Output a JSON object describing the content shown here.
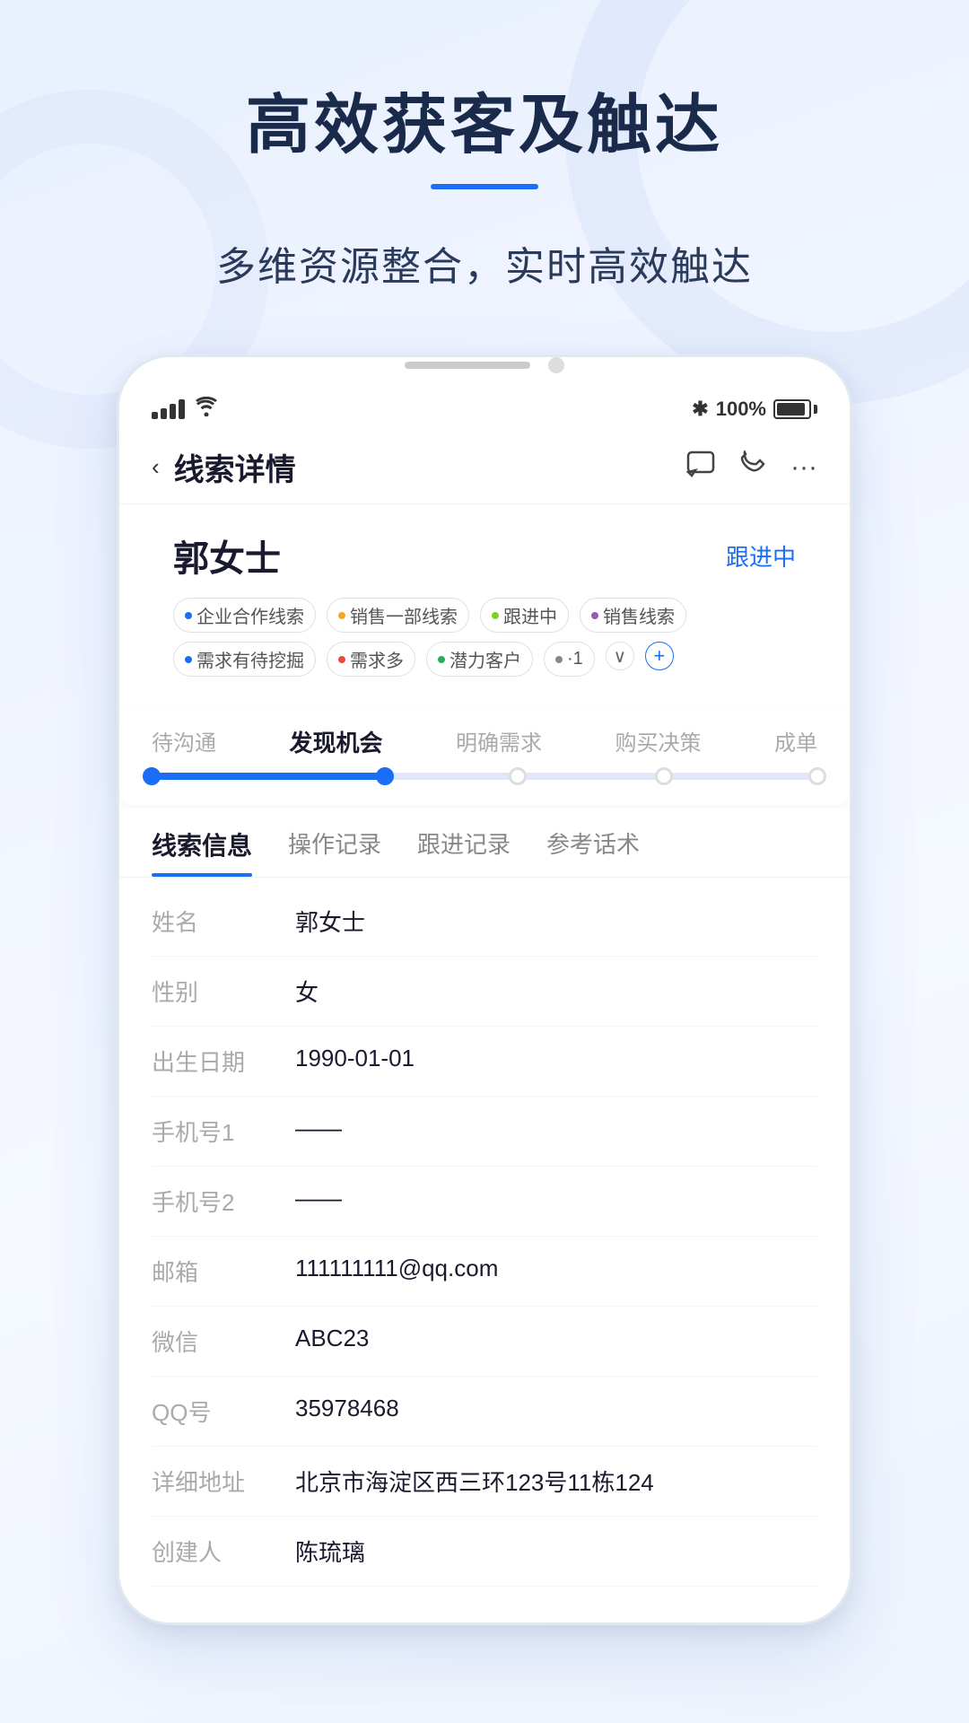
{
  "page": {
    "background": "#e8f0fe"
  },
  "hero": {
    "title": "高效获客及触达",
    "underline_color": "#1a6ef5",
    "subtitle": "多维资源整合，实时高效触达"
  },
  "statusbar": {
    "signal_label": "signal",
    "wifi_label": "wifi",
    "bluetooth": "✱",
    "battery_percent": "100%",
    "battery_label": "battery"
  },
  "navbar": {
    "back_icon": "‹",
    "title": "线索详情",
    "message_icon": "💬",
    "phone_icon": "✆",
    "more_icon": "···"
  },
  "contact": {
    "name": "郭女士",
    "status": "跟进中",
    "tags": [
      {
        "text": "企业合作线索",
        "dot_color": "#1a6ef5"
      },
      {
        "text": "销售一部线索",
        "dot_color": "#f5a623"
      },
      {
        "text": "跟进中",
        "dot_color": "#7ed321"
      },
      {
        "text": "销售线索",
        "dot_color": "#9b59b6"
      }
    ],
    "tags_row2": [
      {
        "text": "需求有待挖掘",
        "dot_color": "#1a6ef5"
      },
      {
        "text": "需求多",
        "dot_color": "#e74c3c"
      },
      {
        "text": "潜力客户",
        "dot_color": "#27ae60"
      },
      {
        "text": "·1",
        "dot_color": "#888"
      }
    ]
  },
  "progress": {
    "tabs": [
      {
        "label": "待沟通",
        "active": false
      },
      {
        "label": "发现机会",
        "active": true
      },
      {
        "label": "明确需求",
        "active": false
      },
      {
        "label": "购买决策",
        "active": false
      },
      {
        "label": "成单",
        "active": false
      }
    ],
    "fill_percent": 35,
    "dots": [
      {
        "position": 0,
        "filled": true
      },
      {
        "position": 35,
        "filled": true
      },
      {
        "position": 55,
        "filled": false
      },
      {
        "position": 77,
        "filled": false
      },
      {
        "position": 100,
        "filled": false
      }
    ]
  },
  "info_tabs": [
    {
      "label": "线索信息",
      "active": true
    },
    {
      "label": "操作记录",
      "active": false
    },
    {
      "label": "跟进记录",
      "active": false
    },
    {
      "label": "参考话术",
      "active": false
    }
  ],
  "info_fields": [
    {
      "label": "姓名",
      "value": "郭女士"
    },
    {
      "label": "性别",
      "value": "女"
    },
    {
      "label": "出生日期",
      "value": "1990-01-01"
    },
    {
      "label": "手机号1",
      "value": "——"
    },
    {
      "label": "手机号2",
      "value": "——"
    },
    {
      "label": "邮箱",
      "value": "111111111@qq.com"
    },
    {
      "label": "微信",
      "value": "ABC23"
    },
    {
      "label": "QQ号",
      "value": "35978468"
    },
    {
      "label": "详细地址",
      "value": "北京市海淀区西三环123号11栋124"
    },
    {
      "label": "创建人",
      "value": "陈琉璃"
    }
  ]
}
